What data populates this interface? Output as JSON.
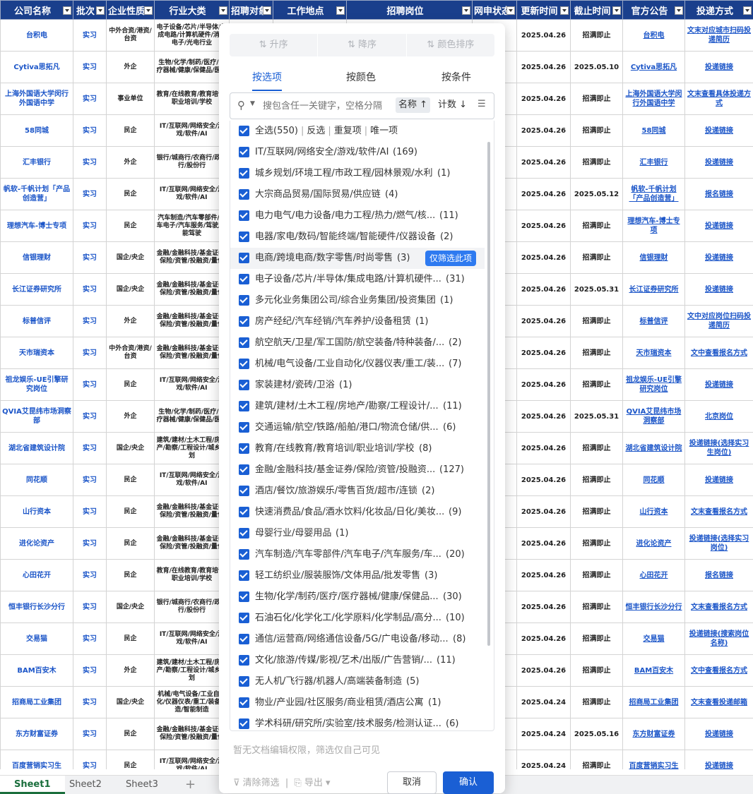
{
  "headers": [
    "公司名称",
    "批次",
    "企业性质",
    "行业大类",
    "招聘对象",
    "工作地点",
    "招聘岗位",
    "网申状态",
    "更新时间",
    "截止时间",
    "官方公告",
    "投递方式"
  ],
  "rows": [
    [
      "台积电",
      "实习",
      "中外合资/港资/台资",
      "电子设备/芯片/半导体/集成电路/计算机硬件/消费电子/光电行业",
      "",
      "",
      "",
      "",
      "2025.04.26",
      "招满即止",
      "台积电",
      "文末对应城市扫码投递简历"
    ],
    [
      "Cytiva思拓凡",
      "实习",
      "外企",
      "生物/化学/制药/医疗/医疗器械/健康/保健品/医院",
      "",
      "",
      "",
      "",
      "2025.04.26",
      "2025.05.10",
      "Cytiva思拓凡",
      "投递链接"
    ],
    [
      "上海外国语大学闵行外国语中学",
      "实习",
      "事业单位",
      "教育/在线教育/教育培训/职业培训/学校",
      "",
      "",
      "",
      "",
      "2025.04.26",
      "招满即止",
      "上海外国语大学闵行外国语中学",
      "文末查看具体投递方式"
    ],
    [
      "58同城",
      "实习",
      "民企",
      "IT/互联网/网络安全/游戏/软件/AI",
      "",
      "",
      "",
      "",
      "2025.04.26",
      "招满即止",
      "58同城",
      "投递链接"
    ],
    [
      "汇丰银行",
      "实习",
      "外企",
      "银行/城商行/农商行/政策行/股份行",
      "",
      "",
      "",
      "",
      "2025.04.26",
      "招满即止",
      "汇丰银行",
      "投递链接"
    ],
    [
      "帆软-千帆计划「产品创造营」",
      "实习",
      "民企",
      "IT/互联网/网络安全/游戏/软件/AI",
      "",
      "",
      "",
      "",
      "2025.04.26",
      "2025.05.12",
      "帆软-千帆计划「产品创造营」",
      "报名链接"
    ],
    [
      "理想汽车-博士专项",
      "实习",
      "民企",
      "汽车制造/汽车零部件/汽车电子/汽车服务/驾驶/智能驾驶",
      "",
      "",
      "",
      "",
      "2025.04.26",
      "招满即止",
      "理想汽车-博士专项",
      "投递链接"
    ],
    [
      "信银理财",
      "实习",
      "国企/央企",
      "金融/金融科技/基金证券/保险/资管/投融资/量化",
      "",
      "",
      "",
      "",
      "2025.04.26",
      "招满即止",
      "信银理财",
      "投递链接"
    ],
    [
      "长江证券研究所",
      "实习",
      "国企/央企",
      "金融/金融科技/基金证券/保险/资管/投融资/量化",
      "",
      "",
      "",
      "",
      "2025.04.26",
      "2025.05.31",
      "长江证券研究所",
      "投递链接"
    ],
    [
      "标普信评",
      "实习",
      "外企",
      "金融/金融科技/基金证券/保险/资管/投融资/量化",
      "",
      "",
      "",
      "",
      "2025.04.26",
      "招满即止",
      "标普信评",
      "文中对应岗位扫码投递简历"
    ],
    [
      "天市瑞资本",
      "实习",
      "中外合资/港资/台资",
      "金融/金融科技/基金证券/保险/资管/投融资/量化",
      "",
      "",
      "",
      "",
      "2025.04.26",
      "招满即止",
      "天市瑞资本",
      "文中查看报名方式"
    ],
    [
      "祖龙娱乐-UE引擎研究岗位",
      "实习",
      "民企",
      "IT/互联网/网络安全/游戏/软件/AI",
      "",
      "",
      "",
      "",
      "2025.04.26",
      "招满即止",
      "祖龙娱乐-UE引擎研究岗位",
      "投递链接"
    ],
    [
      "QVIA艾昆纬市场洞察部",
      "实习",
      "外企",
      "生物/化学/制药/医疗/医疗器械/健康/保健品/医院",
      "",
      "",
      "",
      "",
      "2025.04.26",
      "2025.05.31",
      "QVIA艾昆纬市场洞察部",
      "北京岗位"
    ],
    [
      "湖北省建筑设计院",
      "实习",
      "国企/央企",
      "建筑/建材/土木工程/房地产/勘察/工程设计/城乡规划",
      "",
      "",
      "",
      "",
      "2025.04.26",
      "招满即止",
      "湖北省建筑设计院",
      "投递链接(选择实习生岗位)"
    ],
    [
      "同花顺",
      "实习",
      "民企",
      "IT/互联网/网络安全/游戏/软件/AI",
      "",
      "",
      "",
      "",
      "2025.04.26",
      "招满即止",
      "同花顺",
      "投递链接"
    ],
    [
      "山行资本",
      "实习",
      "民企",
      "金融/金融科技/基金证券/保险/资管/投融资/量化",
      "",
      "",
      "",
      "",
      "2025.04.26",
      "招满即止",
      "山行资本",
      "文末查看报名方式"
    ],
    [
      "进化论资产",
      "实习",
      "民企",
      "金融/金融科技/基金证券/保险/资管/投融资/量化",
      "",
      "",
      "",
      "",
      "2025.04.26",
      "招满即止",
      "进化论资产",
      "投递链接(选择实习岗位)"
    ],
    [
      "心田花开",
      "实习",
      "民企",
      "教育/在线教育/教育培训/职业培训/学校",
      "",
      "",
      "",
      "",
      "2025.04.26",
      "招满即止",
      "心田花开",
      "报名链接"
    ],
    [
      "恒丰银行长沙分行",
      "实习",
      "国企/央企",
      "银行/城商行/农商行/政策行/股份行",
      "",
      "",
      "",
      "",
      "2025.04.26",
      "招满即止",
      "恒丰银行长沙分行",
      "文末查看报名方式"
    ],
    [
      "交易猫",
      "实习",
      "民企",
      "IT/互联网/网络安全/游戏/软件/AI",
      "",
      "",
      "",
      "",
      "2025.04.26",
      "招满即止",
      "交易猫",
      "投递链接(搜索岗位名称)"
    ],
    [
      "BAM百安木",
      "实习",
      "外企",
      "建筑/建材/土木工程/房地产/勘察/工程设计/城乡规划",
      "",
      "",
      "",
      "",
      "2025.04.26",
      "招满即止",
      "BAM百安木",
      "文中查看报名方式"
    ],
    [
      "招商局工业集团",
      "实习",
      "国企/央企",
      "机械/电气设备/工业自动化/仪器仪表/重工/装备制造/智能制造",
      "",
      "",
      "",
      "",
      "2025.04.24",
      "招满即止",
      "招商局工业集团",
      "文末查看投递邮箱"
    ],
    [
      "东方财富证券",
      "实习",
      "民企",
      "金融/金融科技/基金证券/保险/资管/投融资/量化",
      "",
      "",
      "",
      "",
      "2025.04.24",
      "2025.05.16",
      "东方财富证券",
      "投递链接"
    ],
    [
      "百度营销实习生",
      "实习",
      "民企",
      "IT/互联网/网络安全/游戏/软件/AI",
      "",
      "",
      "",
      "",
      "2025.04.24",
      "招满即止",
      "百度营销实习生",
      "投递链接"
    ]
  ],
  "sheets": [
    "Sheet1",
    "Sheet2",
    "Sheet3"
  ],
  "filter": {
    "sort": [
      "升序",
      "降序",
      "颜色排序"
    ],
    "modes": [
      "按选项",
      "按颜色",
      "按条件"
    ],
    "search_placeholder": "搜包含任一关键字，空格分隔",
    "sort_name": "名称 ↑",
    "sort_count": "计数 ↓",
    "top": {
      "all": "全选(550)",
      "invert": "反选",
      "dup": "重复项",
      "unique": "唯一项"
    },
    "only_this": "仅筛选此项",
    "items": [
      {
        "label": "IT/互联网/网络安全/游戏/软件/AI",
        "count": "(169)"
      },
      {
        "label": "城乡规划/环境工程/市政工程/园林景观/水利",
        "count": "(1)"
      },
      {
        "label": "大宗商品贸易/国际贸易/供应链",
        "count": "(4)"
      },
      {
        "label": "电力电气/电力设备/电力工程/热力/燃气/核...",
        "count": "(11)"
      },
      {
        "label": "电器/家电/数码/智能终端/智能硬件/仪器设备",
        "count": "(2)"
      },
      {
        "label": "电商/跨境电商/数字零售/时尚零售",
        "count": "(3)"
      },
      {
        "label": "电子设备/芯片/半导体/集成电路/计算机硬件...",
        "count": "(31)"
      },
      {
        "label": "多元化业务集团公司/综合业务集团/投资集团",
        "count": "(1)"
      },
      {
        "label": "房产经纪/汽车经销/汽车养护/设备租赁",
        "count": "(1)"
      },
      {
        "label": "航空航天/卫星/军工国防/航空装备/特种装备/...",
        "count": "(2)"
      },
      {
        "label": "机械/电气设备/工业自动化/仪器仪表/重工/装...",
        "count": "(7)"
      },
      {
        "label": "家装建材/瓷砖/卫浴",
        "count": "(1)"
      },
      {
        "label": "建筑/建材/土木工程/房地产/勘察/工程设计/...",
        "count": "(11)"
      },
      {
        "label": "交通运输/航空/铁路/船舶/港口/物流仓储/供...",
        "count": "(6)"
      },
      {
        "label": "教育/在线教育/教育培训/职业培训/学校",
        "count": "(8)"
      },
      {
        "label": "金融/金融科技/基金证券/保险/资管/投融资...",
        "count": "(127)"
      },
      {
        "label": "酒店/餐饮/旅游娱乐/零售百货/超市/连锁",
        "count": "(2)"
      },
      {
        "label": "快速消费品/食品/酒水饮料/化妆品/日化/美妆...",
        "count": "(9)"
      },
      {
        "label": "母婴行业/母婴用品",
        "count": "(1)"
      },
      {
        "label": "汽车制造/汽车零部件/汽车电子/汽车服务/车...",
        "count": "(20)"
      },
      {
        "label": "轻工纺织业/服装服饰/文体用品/批发零售",
        "count": "(3)"
      },
      {
        "label": "生物/化学/制药/医疗/医疗器械/健康/保健品...",
        "count": "(30)"
      },
      {
        "label": "石油石化/化学化工/化学原料/化学制品/高分...",
        "count": "(10)"
      },
      {
        "label": "通信/运营商/网络通信设备/5G/广电设备/移动...",
        "count": "(8)"
      },
      {
        "label": "文化/旅游/传媒/影视/艺术/出版/广告营销/...",
        "count": "(11)"
      },
      {
        "label": "无人机/飞行器/机器人/高端装备制造",
        "count": "(5)"
      },
      {
        "label": "物业/产业园/社区服务/商业租赁/酒店公寓",
        "count": "(1)"
      },
      {
        "label": "学术科研/研究所/实验室/技术服务/检测认证...",
        "count": "(6)"
      }
    ],
    "hint": "暂无文档编辑权限，筛选仅自己可见",
    "clear": "清除筛选",
    "export": "导出",
    "cancel": "取消",
    "ok": "确认"
  },
  "colors": {
    "header_bg": "#1a3f8c",
    "accent": "#1a5fd4",
    "link": "#1b55c8"
  }
}
